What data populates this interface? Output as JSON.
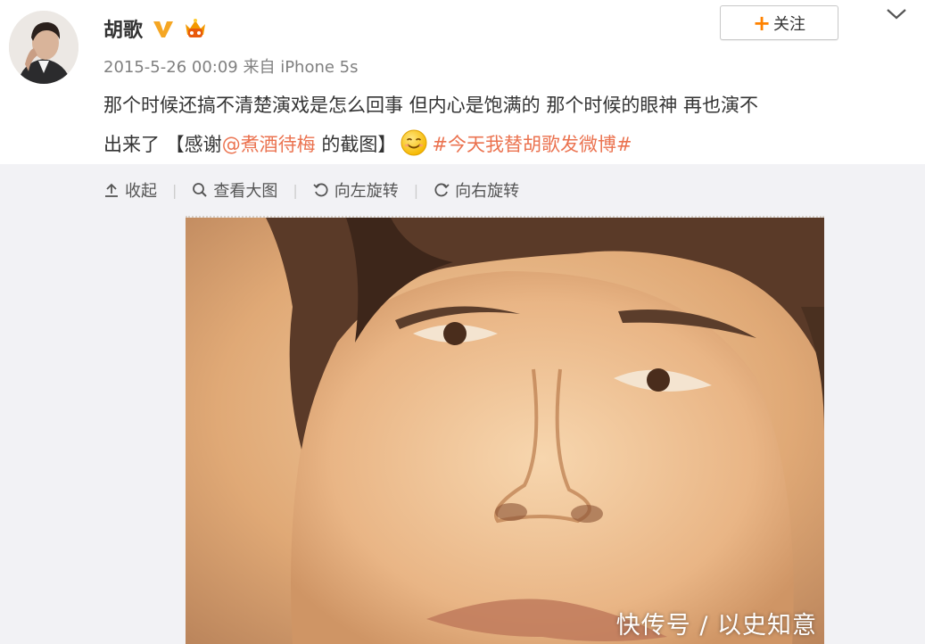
{
  "author": {
    "name": "胡歌",
    "verified_icon": "verified-v-icon",
    "vip_icon": "vip-crown-icon"
  },
  "post": {
    "meta": "2015-5-26 00:09 来自 iPhone 5s",
    "line1": "那个时候还搞不清楚演戏是怎么回事 但内心是饱满的 那个时候的眼神 再也演不",
    "line2_prefix": "出来了 【感谢",
    "mention": "@煮酒待梅",
    "line2_mid": " 的截图】",
    "emoji": "smile-emoji-icon",
    "topic": "#今天我替胡歌发微博#"
  },
  "actions": {
    "follow_plus": "+",
    "follow_label": "关注",
    "dropdown_icon": "chevron-down-icon"
  },
  "toolbar": {
    "collapse": "收起",
    "view_large": "查看大图",
    "rotate_left": "向左旋转",
    "rotate_right": "向右旋转",
    "separator": "|"
  },
  "watermark": "快传号 / 以史知意",
  "colors": {
    "link": "#eb7350",
    "accent": "#ff8200",
    "panel_bg": "#f2f2f5"
  }
}
